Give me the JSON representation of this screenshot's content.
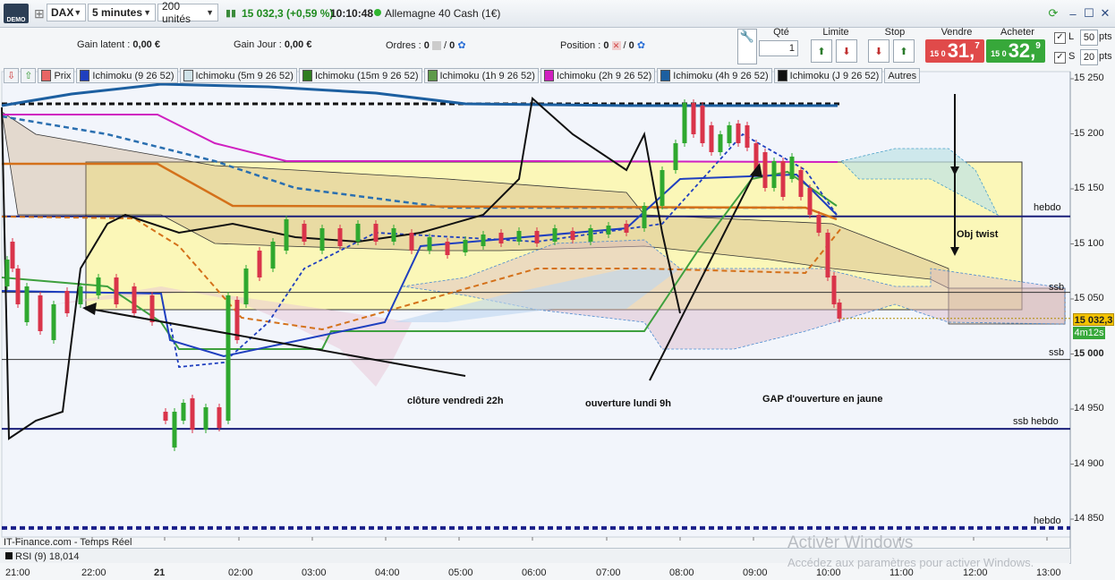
{
  "toolbar": {
    "demo_badge": "DEMO",
    "instrument": "DAX",
    "timeframe": "5 minutes",
    "units": "200 unités",
    "price_change": "15 032,3 (+0,59 %)",
    "time": "10:10:48",
    "market_name": "Allemagne 40 Cash (1€)",
    "colors": {
      "live_dot": "#2fb52f",
      "change_text": "#1f8a1f"
    }
  },
  "info": {
    "gain_latent_label": "Gain latent :",
    "gain_latent_value": "0,00 €",
    "gain_jour_label": "Gain Jour :",
    "gain_jour_value": "0,00 €",
    "ordres_label": "Ordres :",
    "ordres_count": "0",
    "ordres_count2": "0",
    "position_label": "Position :",
    "position_count": "0",
    "position_count2": "0"
  },
  "order_panel": {
    "qty_label": "Qté",
    "qty_value": "1",
    "limit_label": "Limite",
    "stop_label": "Stop",
    "sell_label": "Vendre",
    "sell_prefix": "15 0",
    "sell_big": "31,",
    "sell_sup": "7",
    "buy_label": "Acheter",
    "buy_prefix": "15 0",
    "buy_big": "32,",
    "buy_sup": "9",
    "l_label": "L",
    "l_pts": "50",
    "s_label": "S",
    "s_pts": "20",
    "pts_label": "pts",
    "colors": {
      "sell": "#e04a4a",
      "buy": "#37a83a"
    }
  },
  "legend": [
    {
      "label": "Prix",
      "color": "#e86565"
    },
    {
      "label": "Ichimoku (9 26 52)",
      "color": "#1f3fbf"
    },
    {
      "label": "Ichimoku (5m 9 26 52)",
      "color": "#cfe2e8"
    },
    {
      "label": "Ichimoku (15m 9 26 52)",
      "color": "#2f7d1f"
    },
    {
      "label": "Ichimoku (1h 9 26 52)",
      "color": "#5e9a4a"
    },
    {
      "label": "Ichimoku (2h 9 26 52)",
      "color": "#d020c0"
    },
    {
      "label": "Ichimoku (4h 9 26 52)",
      "color": "#1c5fa0"
    },
    {
      "label": "Ichimoku (J 9 26 52)",
      "color": "#111111"
    },
    {
      "label": "Autres",
      "color": ""
    }
  ],
  "chart": {
    "source": "IT-Finance.com - Temps Réel",
    "rsi_label": "RSI (9) 18,014",
    "current_price_tag": "15 032,3",
    "countdown_tag": "4m12s",
    "annotations": {
      "cloture": "clôture vendredi  22h",
      "ouverture": "ouverture lundi 9h",
      "gap": "GAP d'ouverture en jaune",
      "obj": "Obj twist"
    },
    "levels": {
      "hebdo_top": "hebdo",
      "ssb_1": "ssb",
      "ssb_2": "ssb",
      "ssb_hebdo": "ssb hebdo",
      "hebdo_bottom": "hebdo"
    },
    "watermark_title": "Activer Windows",
    "watermark_sub": "Accédez aux paramètres pour activer Windows.",
    "colors": {
      "gap_zone": "#fbf7b8",
      "up": "#2fa82f",
      "down": "#d9344a"
    }
  },
  "chart_data": {
    "type": "line",
    "title": "",
    "y_ticks": [
      "15 250",
      "15 200",
      "15 150",
      "15 100",
      "15 050",
      "15 000",
      "14 950",
      "14 900",
      "14 850"
    ],
    "x_ticks": [
      "21:00",
      "22:00",
      "21",
      "02:00",
      "03:00",
      "04:00",
      "05:00",
      "06:00",
      "07:00",
      "08:00",
      "09:00",
      "10:00",
      "11:00",
      "12:00",
      "13:00"
    ],
    "ylim": [
      14830,
      15260
    ],
    "horizontal_levels": [
      {
        "label": "hebdo",
        "value": 15125
      },
      {
        "label": "ssb",
        "value": 15056
      },
      {
        "label": "ssb",
        "value": 14995
      },
      {
        "label": "ssb hebdo",
        "value": 14932
      },
      {
        "label": "hebdo",
        "value": 14842
      }
    ],
    "current_price": 15032.3
  }
}
